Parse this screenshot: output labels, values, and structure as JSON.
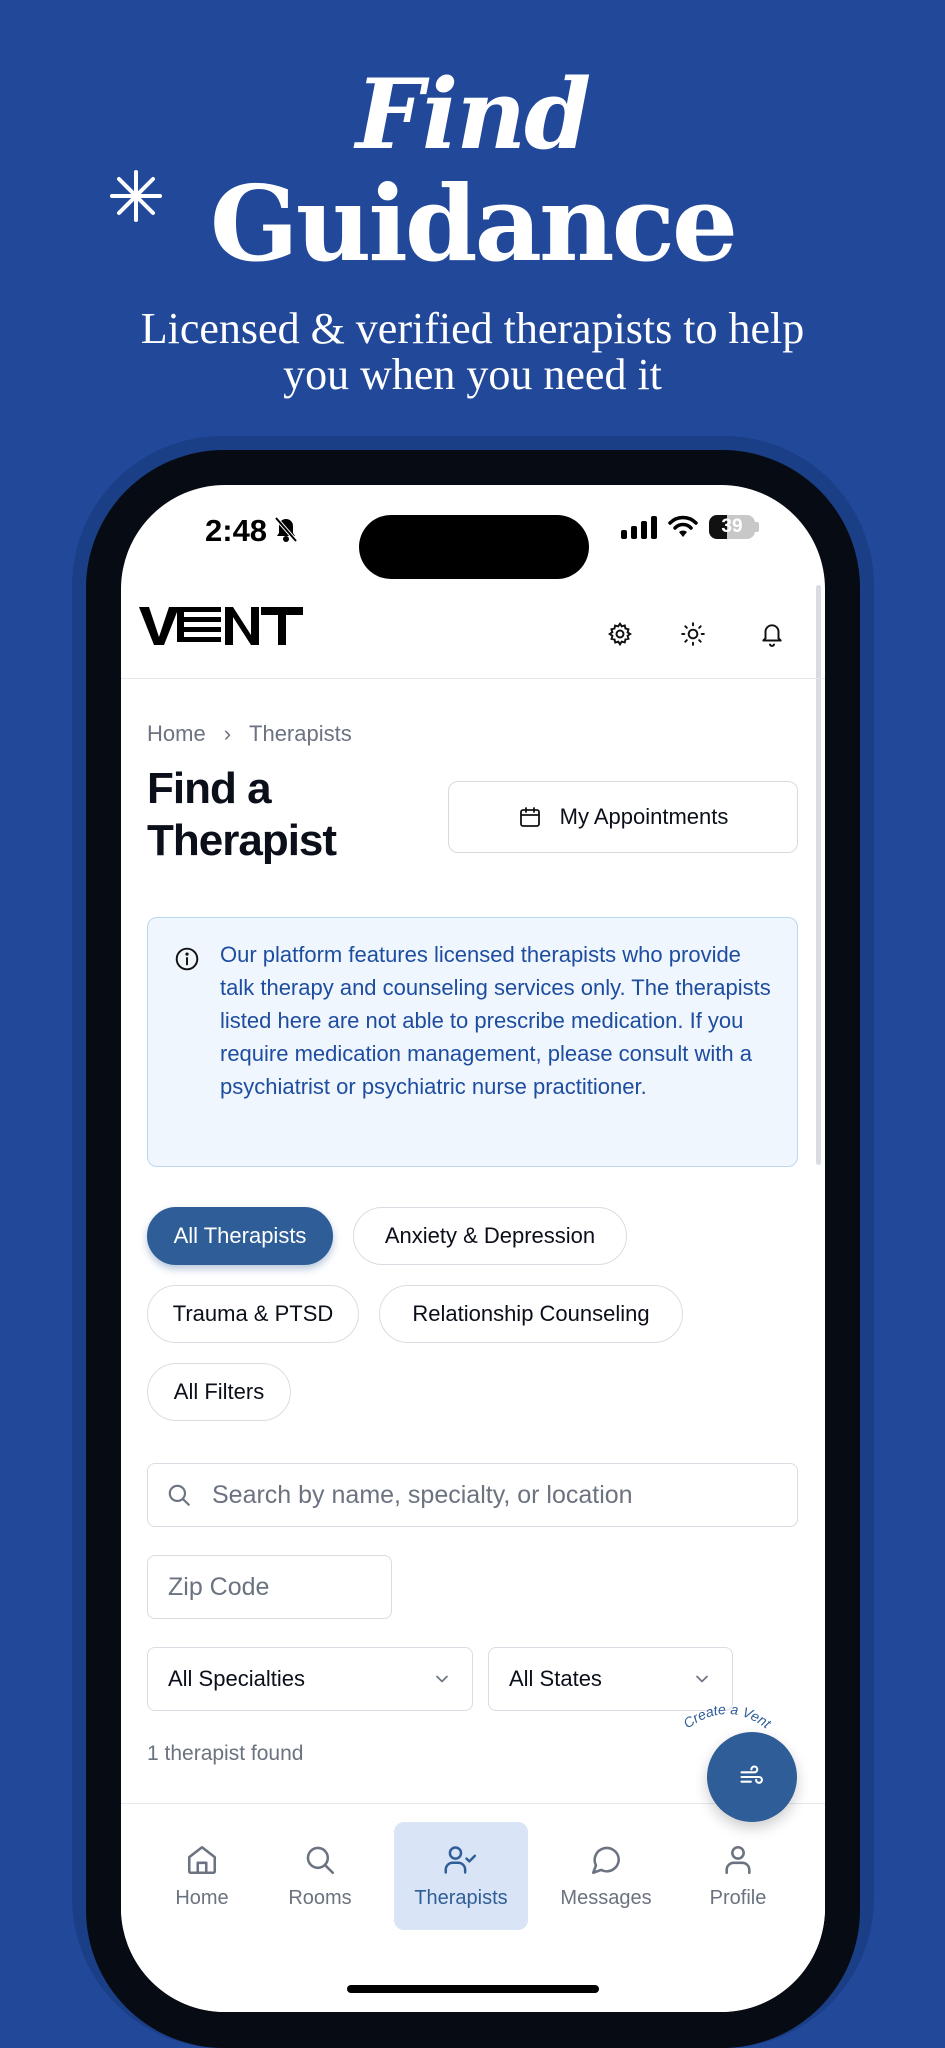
{
  "promo": {
    "title_line1": "Find",
    "title_line2": "Guidance",
    "subtitle": "Licensed & verified therapists to help you when you need it"
  },
  "status_bar": {
    "time": "2:48",
    "battery": "39"
  },
  "app": {
    "logo": "VENT"
  },
  "breadcrumb": {
    "home": "Home",
    "separator": "›",
    "current": "Therapists"
  },
  "page": {
    "title": "Find a Therapist",
    "appointments_button": "My Appointments"
  },
  "notice": {
    "text": "Our platform features licensed therapists who provide talk therapy and counseling services only. The therapists listed here are not able to prescribe medication. If you require medication management, please consult with a psychiatrist or psychiatric nurse practitioner."
  },
  "filters": {
    "chips": [
      {
        "label": "All Therapists",
        "active": true
      },
      {
        "label": "Anxiety & Depression",
        "active": false
      },
      {
        "label": "Trauma & PTSD",
        "active": false
      },
      {
        "label": "Relationship Counseling",
        "active": false
      },
      {
        "label": "All Filters",
        "active": false
      }
    ]
  },
  "search": {
    "placeholder": "Search by name, specialty, or location"
  },
  "zip": {
    "placeholder": "Zip Code"
  },
  "selects": {
    "specialty": "All Specialties",
    "state": "All States"
  },
  "results": {
    "count_text": "1 therapist found"
  },
  "fab": {
    "label": "Create a Vent"
  },
  "nav": {
    "items": [
      {
        "label": "Home",
        "icon": "home-icon"
      },
      {
        "label": "Rooms",
        "icon": "search-icon"
      },
      {
        "label": "Therapists",
        "icon": "user-check-icon",
        "active": true
      },
      {
        "label": "Messages",
        "icon": "message-circle-icon"
      },
      {
        "label": "Profile",
        "icon": "user-icon"
      }
    ]
  },
  "colors": {
    "background": "#22489a",
    "accent": "#2f5d97",
    "notice_bg": "#eff6fd",
    "notice_text": "#1e4da0"
  }
}
